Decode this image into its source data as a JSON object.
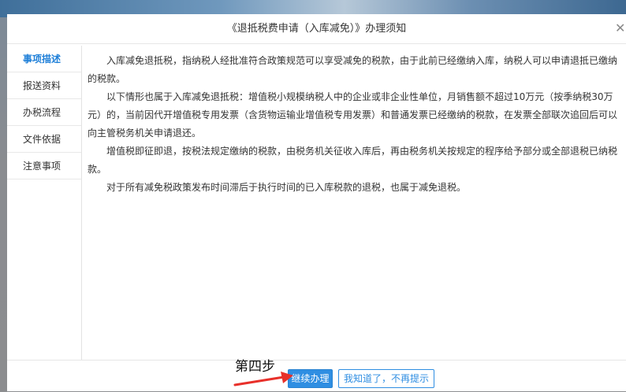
{
  "dialog": {
    "title": "《退抵税费申请（入库减免）》办理须知",
    "close_icon": "close-icon"
  },
  "nav": {
    "items": [
      {
        "label": "事项描述",
        "active": true
      },
      {
        "label": "报送资料",
        "active": false
      },
      {
        "label": "办税流程",
        "active": false
      },
      {
        "label": "文件依据",
        "active": false
      },
      {
        "label": "注意事项",
        "active": false
      }
    ]
  },
  "content": {
    "paragraphs": [
      "入库减免退抵税，指纳税人经批准符合政策规范可以享受减免的税款，由于此前已经缴纳入库，纳税人可以申请退抵已缴纳的税款。",
      "以下情形也属于入库减免退抵税：增值税小规模纳税人中的企业或非企业性单位，月销售额不超过10万元（按季纳税30万元）的，当前因代开增值税专用发票（含货物运输业增值税专用发票）和普通发票已经缴纳的税款，在发票全部联次追回后可以向主管税务机关申请退还。",
      "增值税即征即退，按税法规定缴纳的税款，由税务机关征收入库后，再由税务机关按规定的程序给予部分或全部退税已纳税款。",
      "对于所有减免税政策发布时间滞后于执行时间的已入库税款的退税，也属于减免退税。"
    ]
  },
  "footer": {
    "continue_label": "继续办理",
    "dismiss_label": "我知道了，不再提示"
  },
  "annotation": {
    "step_label": "第四步",
    "arrow_color": "#e8302a"
  },
  "colors": {
    "accent": "#2f8ee2",
    "active_nav": "#1e7fd8"
  }
}
